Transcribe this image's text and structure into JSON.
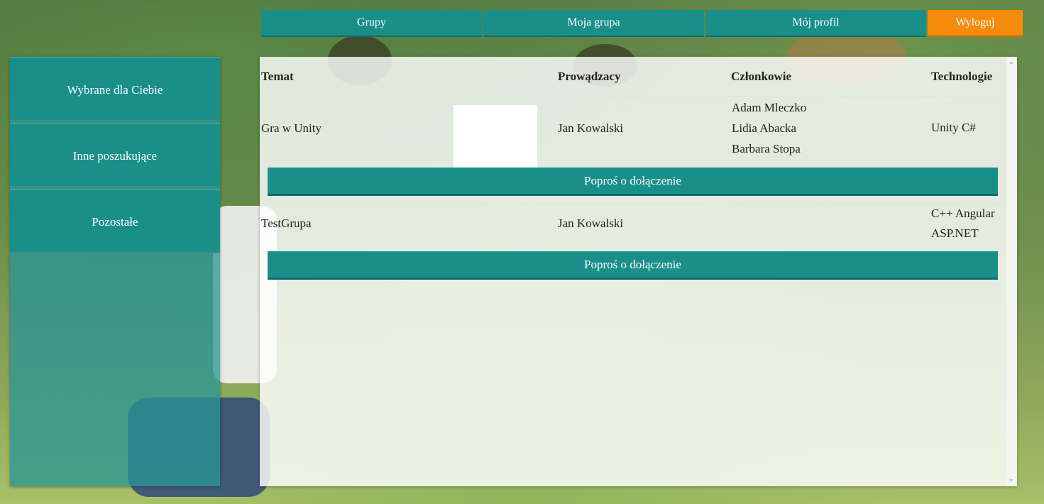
{
  "nav": {
    "groups": "Grupy",
    "my_group": "Moja grupa",
    "my_profile": "Mój profil",
    "logout": "Wyloguj"
  },
  "sidebar": {
    "items": [
      {
        "label": "Wybrane dla Ciebie"
      },
      {
        "label": "Inne poszukujące"
      },
      {
        "label": "Pozostałe"
      }
    ]
  },
  "table": {
    "headers": {
      "topic": "Temat",
      "leader": "Prowądzacy",
      "members": "Członkowie",
      "technologies": "Technologie"
    },
    "rows": [
      {
        "topic": "Gra w Unity",
        "leader": "Jan Kowalski",
        "members": [
          "Adam Mleczko",
          "Lidia Abacka",
          "Barbara Stopa"
        ],
        "technologies": [
          "Unity C#"
        ],
        "join_label": "Poproś o dołączenie"
      },
      {
        "topic": "TestGrupa",
        "leader": "Jan Kowalski",
        "members": [],
        "technologies": [
          "C++ Angular",
          "ASP.NET"
        ],
        "join_label": "Poproś o dołączenie"
      }
    ]
  },
  "colors": {
    "accent": "#1a8f8a",
    "logout": "#f58a0b"
  }
}
